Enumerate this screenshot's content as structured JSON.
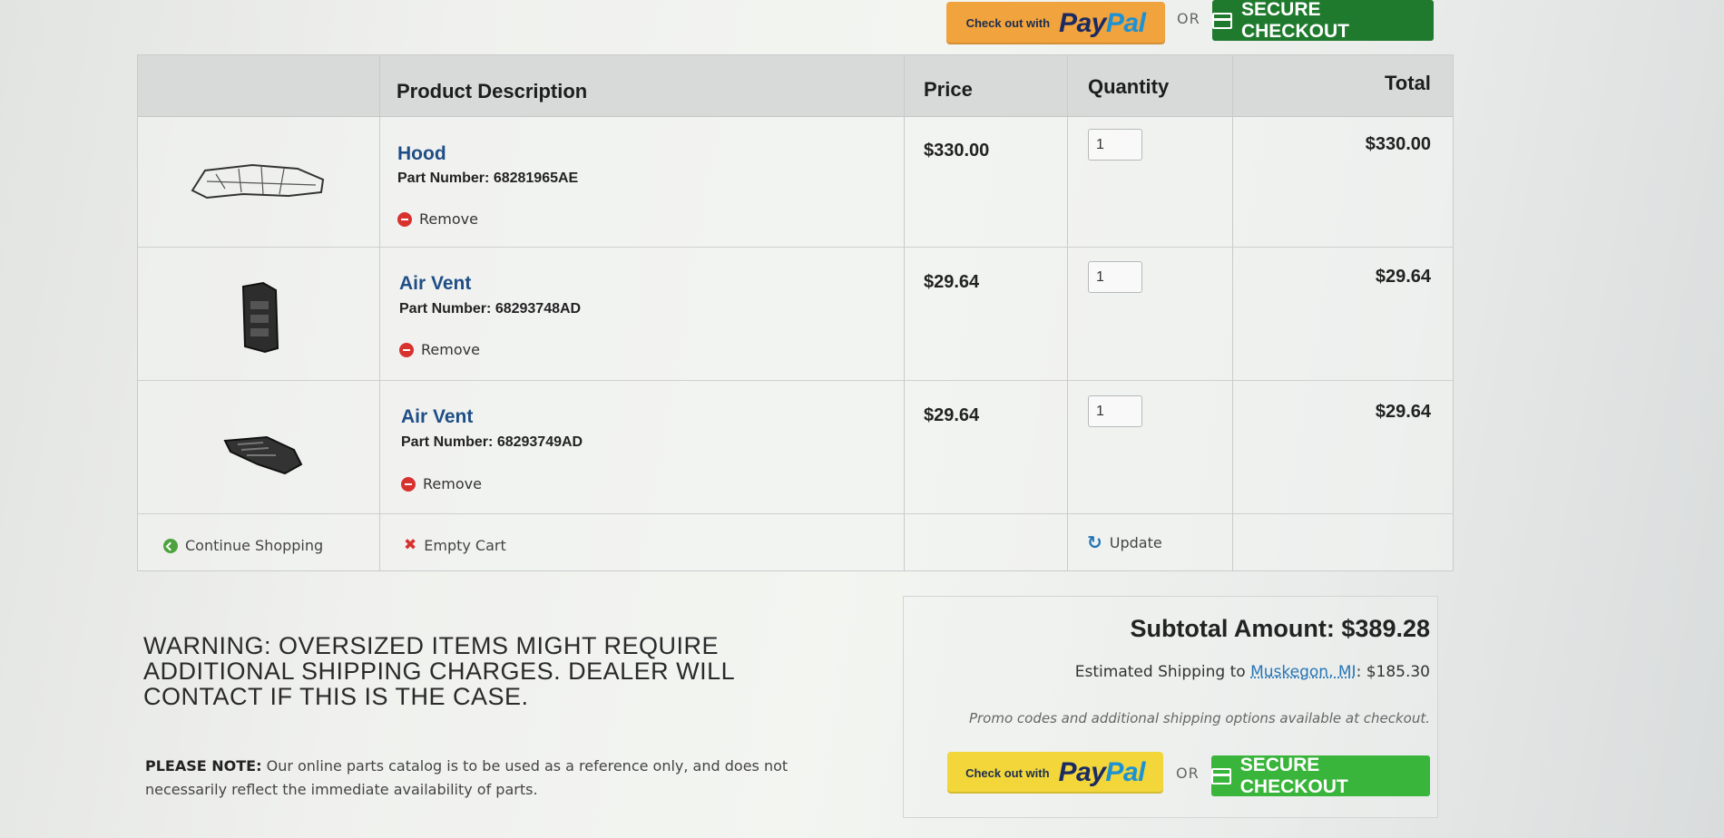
{
  "header_checkout": {
    "paypal_small": "Check out with",
    "paypal_logo_part1": "Pay",
    "paypal_logo_part2": "Pal",
    "or_label": "OR",
    "secure_label": "SECURE CHECKOUT"
  },
  "cart": {
    "headers": {
      "product": "Product Description",
      "price": "Price",
      "quantity": "Quantity",
      "total": "Total"
    },
    "items": [
      {
        "name": "Hood",
        "part_label": "Part Number:",
        "part_number": "68281965AE",
        "remove_label": "Remove",
        "price": "$330.00",
        "quantity": "1",
        "total": "$330.00",
        "thumb_icon": "hood-part-image"
      },
      {
        "name": "Air Vent",
        "part_label": "Part Number:",
        "part_number": "68293748AD",
        "remove_label": "Remove",
        "price": "$29.64",
        "quantity": "1",
        "total": "$29.64",
        "thumb_icon": "air-vent-part-image"
      },
      {
        "name": "Air Vent",
        "part_label": "Part Number:",
        "part_number": "68293749AD",
        "remove_label": "Remove",
        "price": "$29.64",
        "quantity": "1",
        "total": "$29.64",
        "thumb_icon": "air-vent-part-image"
      }
    ],
    "footer": {
      "continue_label": "Continue Shopping",
      "empty_label": "Empty Cart",
      "update_label": "Update"
    }
  },
  "warning": "WARNING: OVERSIZED ITEMS MIGHT REQUIRE ADDITIONAL SHIPPING CHARGES. DEALER WILL CONTACT IF THIS IS THE CASE.",
  "note": {
    "label": "PLEASE NOTE:",
    "text": "Our online parts catalog is to be used as a reference only, and does not necessarily reflect the immediate availability of parts."
  },
  "summary": {
    "subtotal": "Subtotal Amount: $389.28",
    "shipping_prefix": "Estimated Shipping to",
    "shipping_location": "Muskegon, MI",
    "shipping_amount": ": $185.30",
    "promo": "Promo codes and additional shipping options available at checkout."
  },
  "footer_checkout": {
    "paypal_small": "Check out with",
    "paypal_logo_part1": "Pay",
    "paypal_logo_part2": "Pal",
    "or_label": "OR",
    "secure_label": "SECURE CHECKOUT"
  },
  "colors": {
    "paypal_top": "#f1a33d",
    "paypal_bottom": "#f2d63a",
    "secure_top": "#1f7a2d",
    "secure_bottom": "#39b53b",
    "link_blue": "#1f4e86"
  }
}
